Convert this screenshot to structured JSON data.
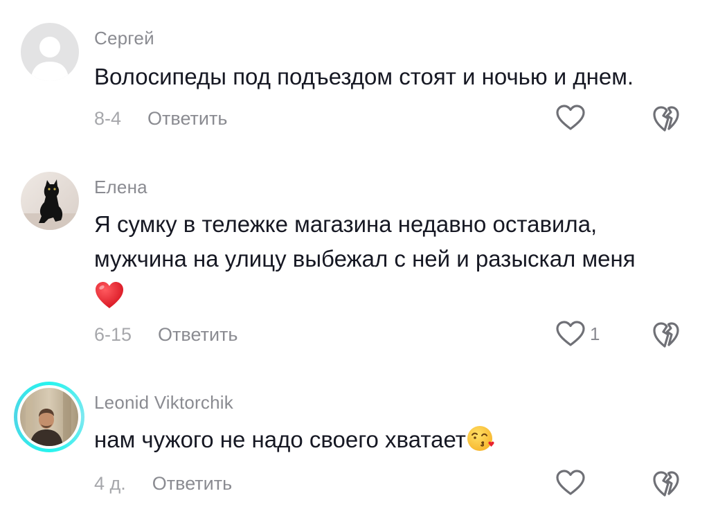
{
  "comments": [
    {
      "username": "Сергей",
      "text": "Волосипеды под подъездом стоят и ночью и днем.",
      "date": "8-4",
      "reply_label": "Ответить",
      "likes": "",
      "avatar": "default-avatar-icon"
    },
    {
      "username": "Елена",
      "text_line1": "Я сумку в тележке магазина недавно оставила,",
      "text_line2": "мужчина на улицу выбежал с ней и разыскал меня",
      "emoji": "❤️",
      "date": "6-15",
      "reply_label": "Ответить",
      "likes": "1",
      "avatar": "black-cat-photo"
    },
    {
      "username": "Leonid Viktorchik",
      "text": "нам чужого не надо своего хватает",
      "emoji": "😘",
      "date": "4 д.",
      "reply_label": "Ответить",
      "likes": "",
      "avatar": "man-photo",
      "story_ring_color": "#25f4ee"
    }
  ],
  "colors": {
    "text": "#161823",
    "muted": "#8a8b91",
    "date": "#a6a7ab",
    "heart": "#e8222e"
  }
}
